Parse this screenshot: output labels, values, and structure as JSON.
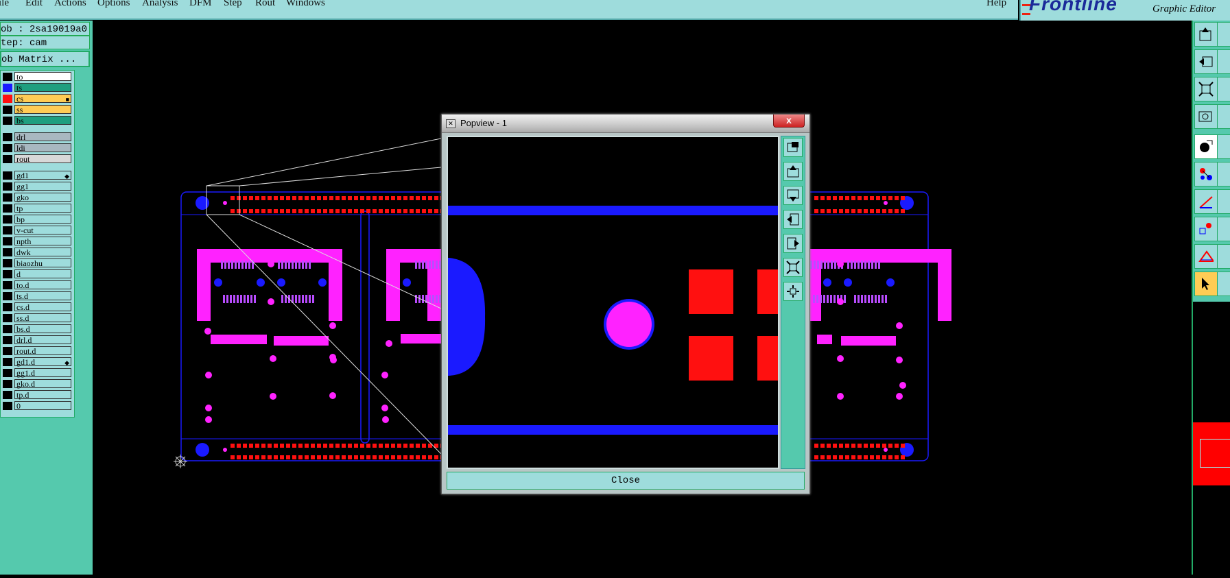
{
  "menu": [
    "ile",
    "Edit",
    "Actions",
    "Options",
    "Analysis",
    "DFM",
    "Step",
    "Rout",
    "Windows",
    "Help"
  ],
  "brand": {
    "logo": "Frontline",
    "app": "Graphic Editor"
  },
  "job": {
    "name": "ob : 2sa19019a0",
    "step": "tep: cam",
    "matrix_button": "ob Matrix ..."
  },
  "layers": [
    {
      "name": "to",
      "bg": "#ffffff",
      "swatch": "#000000",
      "mark": ""
    },
    {
      "name": "ts",
      "bg": "#1f9f7f",
      "swatch": "#1a1aff",
      "mark": ""
    },
    {
      "name": "cs",
      "bg": "#ffcc55",
      "swatch": "#ff1010",
      "mark": "■"
    },
    {
      "name": "ss",
      "bg": "#ffcc55",
      "swatch": "#000000",
      "mark": ""
    },
    {
      "name": "bs",
      "bg": "#1f9f7f",
      "swatch": "#000000",
      "mark": ""
    },
    {
      "name": "drl",
      "bg": "#a8b8c0",
      "swatch": "#000000",
      "mark": ""
    },
    {
      "name": "ldi",
      "bg": "#a8b8c0",
      "swatch": "#000000",
      "mark": ""
    },
    {
      "name": "rout",
      "bg": "#d8d8d8",
      "swatch": "#000000",
      "mark": ""
    },
    {
      "name": "gd1",
      "bg": "#9edcdc",
      "swatch": "#000000",
      "mark": "◆"
    },
    {
      "name": "gg1",
      "bg": "#9edcdc",
      "swatch": "#000000",
      "mark": ""
    },
    {
      "name": "gko",
      "bg": "#9edcdc",
      "swatch": "#000000",
      "mark": ""
    },
    {
      "name": "tp",
      "bg": "#9edcdc",
      "swatch": "#000000",
      "mark": ""
    },
    {
      "name": "bp",
      "bg": "#9edcdc",
      "swatch": "#000000",
      "mark": ""
    },
    {
      "name": "v-cut",
      "bg": "#9edcdc",
      "swatch": "#000000",
      "mark": ""
    },
    {
      "name": "npth",
      "bg": "#9edcdc",
      "swatch": "#000000",
      "mark": ""
    },
    {
      "name": "dwk",
      "bg": "#9edcdc",
      "swatch": "#000000",
      "mark": ""
    },
    {
      "name": "biaozhu",
      "bg": "#9edcdc",
      "swatch": "#000000",
      "mark": ""
    },
    {
      "name": "d",
      "bg": "#9edcdc",
      "swatch": "#000000",
      "mark": ""
    },
    {
      "name": "to.d",
      "bg": "#9edcdc",
      "swatch": "#000000",
      "mark": ""
    },
    {
      "name": "ts.d",
      "bg": "#9edcdc",
      "swatch": "#000000",
      "mark": ""
    },
    {
      "name": "cs.d",
      "bg": "#9edcdc",
      "swatch": "#000000",
      "mark": ""
    },
    {
      "name": "ss.d",
      "bg": "#9edcdc",
      "swatch": "#000000",
      "mark": ""
    },
    {
      "name": "bs.d",
      "bg": "#9edcdc",
      "swatch": "#000000",
      "mark": ""
    },
    {
      "name": "drl.d",
      "bg": "#9edcdc",
      "swatch": "#000000",
      "mark": ""
    },
    {
      "name": "rout.d",
      "bg": "#9edcdc",
      "swatch": "#000000",
      "mark": ""
    },
    {
      "name": "gd1.d",
      "bg": "#9edcdc",
      "swatch": "#000000",
      "mark": "◆"
    },
    {
      "name": "gg1.d",
      "bg": "#9edcdc",
      "swatch": "#000000",
      "mark": ""
    },
    {
      "name": "gko.d",
      "bg": "#9edcdc",
      "swatch": "#000000",
      "mark": ""
    },
    {
      "name": "tp.d",
      "bg": "#9edcdc",
      "swatch": "#000000",
      "mark": ""
    },
    {
      "name": "0",
      "bg": "#9edcdc",
      "swatch": "#000000",
      "mark": ""
    }
  ],
  "popview": {
    "title": "Popview - 1",
    "close_x": "x",
    "close_button": "Close"
  },
  "colors": {
    "panel": "#55c9ad",
    "button": "#9edcdc",
    "pad": "#ff1010",
    "mask": "#ff22ff",
    "outline": "#1a1aff"
  }
}
